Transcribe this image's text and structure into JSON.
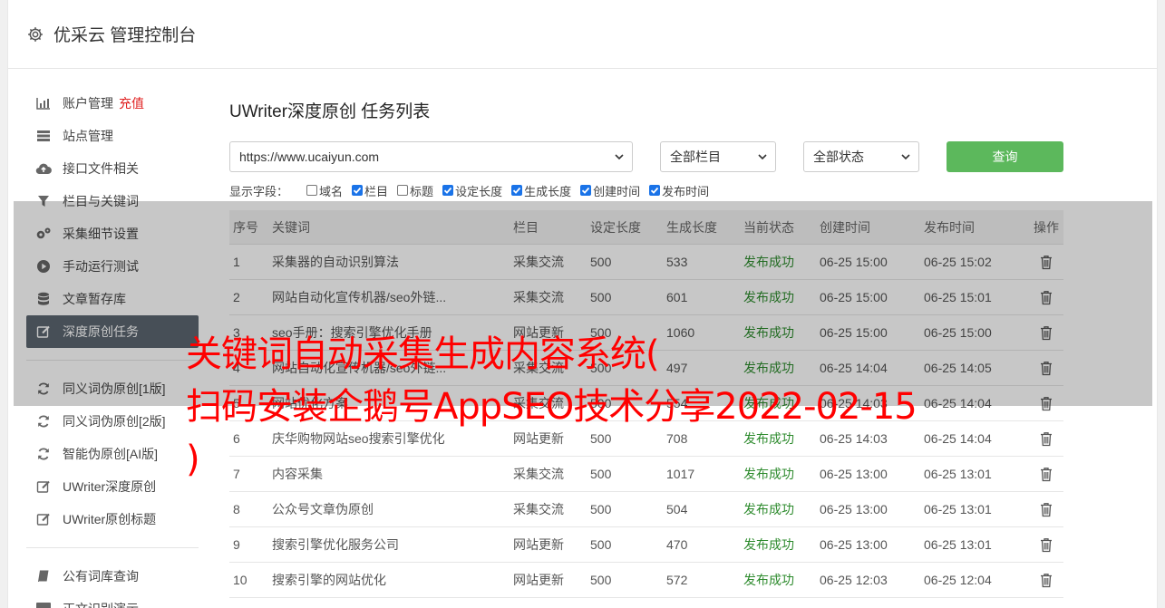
{
  "app": {
    "title": "优采云 管理控制台",
    "title_icon": "gear-icon"
  },
  "sidebar": {
    "groups": [
      [
        {
          "label": "账户管理",
          "extra": "充值",
          "icon": "bar-chart-icon"
        },
        {
          "label": "站点管理",
          "icon": "server-icon"
        },
        {
          "label": "接口文件相关",
          "icon": "cloud-upload-icon"
        },
        {
          "label": "栏目与关键词",
          "icon": "filter-icon"
        },
        {
          "label": "采集细节设置",
          "icon": "cogs-icon"
        },
        {
          "label": "手动运行测试",
          "icon": "play-icon"
        },
        {
          "label": "文章暂存库",
          "icon": "database-icon"
        },
        {
          "label": "深度原创任务",
          "icon": "edit-icon",
          "active": true
        }
      ],
      [
        {
          "label": "同义词伪原创[1版]",
          "icon": "refresh-icon"
        },
        {
          "label": "同义词伪原创[2版]",
          "icon": "refresh-icon"
        },
        {
          "label": "智能伪原创[AI版]",
          "icon": "refresh-icon"
        },
        {
          "label": "UWriter深度原创",
          "icon": "edit-icon"
        },
        {
          "label": "UWriter原创标题",
          "icon": "edit-icon"
        }
      ],
      [
        {
          "label": "公有词库查询",
          "icon": "book-icon"
        },
        {
          "label": "正文识别演示",
          "icon": "monitor-icon"
        }
      ]
    ]
  },
  "main": {
    "title": "UWriter深度原创 任务列表",
    "filters": {
      "site": "https://www.ucaiyun.com",
      "column": "全部栏目",
      "status": "全部状态",
      "query_label": "查询"
    },
    "fields_label": "显示字段：",
    "fields": [
      {
        "label": "域名",
        "checked": false
      },
      {
        "label": "栏目",
        "checked": true
      },
      {
        "label": "标题",
        "checked": false
      },
      {
        "label": "设定长度",
        "checked": true
      },
      {
        "label": "生成长度",
        "checked": true
      },
      {
        "label": "创建时间",
        "checked": true
      },
      {
        "label": "发布时间",
        "checked": true
      }
    ],
    "table": {
      "headers": [
        "序号",
        "关键词",
        "栏目",
        "设定长度",
        "生成长度",
        "当前状态",
        "创建时间",
        "发布时间",
        "操作"
      ],
      "rows": [
        [
          "1",
          "采集器的自动识别算法",
          "采集交流",
          "500",
          "533",
          "发布成功",
          "06-25 15:00",
          "06-25 15:02"
        ],
        [
          "2",
          "网站自动化宣传机器/seo外链...",
          "采集交流",
          "500",
          "601",
          "发布成功",
          "06-25 15:00",
          "06-25 15:01"
        ],
        [
          "3",
          "seo手册：搜索引擎优化手册",
          "网站更新",
          "500",
          "1060",
          "发布成功",
          "06-25 15:00",
          "06-25 15:00"
        ],
        [
          "4",
          "网站自动化宣传机器/seo外链...",
          "采集交流",
          "500",
          "497",
          "发布成功",
          "06-25 14:04",
          "06-25 14:05"
        ],
        [
          "5",
          "网站优化方案",
          "采集交流",
          "500",
          "554",
          "发布成功",
          "06-25 14:03",
          "06-25 14:04"
        ],
        [
          "6",
          "庆华购物网站seo搜索引擎优化",
          "网站更新",
          "500",
          "708",
          "发布成功",
          "06-25 14:03",
          "06-25 14:04"
        ],
        [
          "7",
          "内容采集",
          "采集交流",
          "500",
          "1017",
          "发布成功",
          "06-25 13:00",
          "06-25 13:01"
        ],
        [
          "8",
          "公众号文章伪原创",
          "采集交流",
          "500",
          "504",
          "发布成功",
          "06-25 13:00",
          "06-25 13:01"
        ],
        [
          "9",
          "搜索引擎优化服务公司",
          "网站更新",
          "500",
          "470",
          "发布成功",
          "06-25 13:00",
          "06-25 13:01"
        ],
        [
          "10",
          "搜索引擎的网站优化",
          "网站更新",
          "500",
          "572",
          "发布成功",
          "06-25 12:03",
          "06-25 12:04"
        ]
      ]
    }
  },
  "overlay": {
    "lines": [
      "关键词自动采集生成内容系统(",
      "扫码安装企鹅号AppSEO技术分享2022-02-15",
      ")"
    ]
  },
  "colors": {
    "accent": "#5cb85c",
    "active_nav": "#5c6670",
    "success": "#2e8b2e",
    "overlay_text": "#ff0000",
    "recharge": "#e02020"
  }
}
